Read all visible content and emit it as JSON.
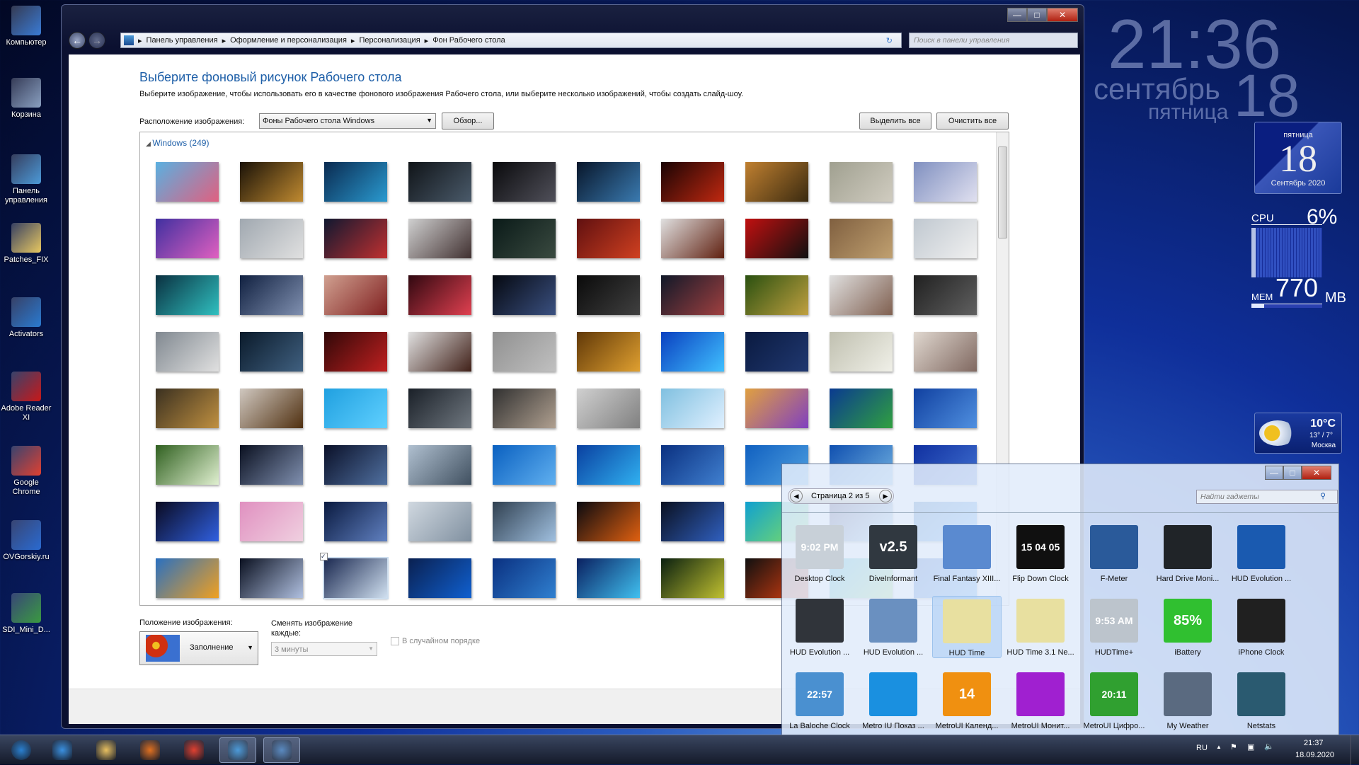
{
  "desktop": {
    "icons": [
      {
        "label": "Компьютер",
        "icon": "computer-icon",
        "color": "#3a7bd5"
      },
      {
        "label": "Корзина",
        "icon": "recycle-bin-icon",
        "color": "#8aa0c0"
      },
      {
        "label": "Панель управления",
        "icon": "control-panel-icon",
        "color": "#4c9ad8"
      },
      {
        "label": "Patches_FIX",
        "icon": "folder-icon",
        "color": "#e8c860"
      },
      {
        "label": "Activators",
        "icon": "activators-icon",
        "color": "#2a7ad0"
      },
      {
        "label": "Adobe Reader XI",
        "icon": "adobe-reader-icon",
        "color": "#c81818"
      },
      {
        "label": "Google Chrome",
        "icon": "chrome-icon",
        "color": "#e04030"
      },
      {
        "label": "OVGorskiy.ru",
        "icon": "ovgorskiy-icon",
        "color": "#2a6ad0"
      },
      {
        "label": "SDI_Mini_D...",
        "icon": "sdi-icon",
        "color": "#3a9a40"
      }
    ]
  },
  "window": {
    "controls": {
      "minimize": "—",
      "maximize": "□",
      "close": "✕"
    },
    "nav": {
      "back": "←",
      "forward": "→"
    },
    "breadcrumb": [
      "Панель управления",
      "Оформление и персонализация",
      "Персонализация",
      "Фон Рабочего стола"
    ],
    "search_placeholder": "Поиск в панели управления",
    "title": "Выберите фоновый рисунок Рабочего стола",
    "description": "Выберите изображение, чтобы использовать его в качестве фонового изображения Рабочего стола, или выберите несколько изображений, чтобы создать слайд-шоу.",
    "location_label": "Расположение изображения:",
    "location_value": "Фоны Рабочего стола Windows",
    "browse": "Обзор...",
    "select_all": "Выделить все",
    "clear_all": "Очистить все",
    "group_label": "Windows (249)",
    "thumbnail_colors": [
      [
        "#5ab0e0",
        "#e06080"
      ],
      [
        "#1a1208",
        "#c08a30"
      ],
      [
        "#0a2a50",
        "#2a9ad0"
      ],
      [
        "#101418",
        "#4a5a6a"
      ],
      [
        "#0a0a0c",
        "#50505a"
      ],
      [
        "#08162a",
        "#3a7ab0"
      ],
      [
        "#1a0404",
        "#c02810"
      ],
      [
        "#c08030",
        "#3a2a10"
      ],
      [
        "#a0a090",
        "#d0ccc0"
      ],
      [
        "#8090c0",
        "#e0e0f0"
      ],
      [
        "#4030a0",
        "#e060c0"
      ],
      [
        "#a0a8b0",
        "#e0e0e0"
      ],
      [
        "#101830",
        "#c03030"
      ],
      [
        "#d0d0d0",
        "#403030"
      ],
      [
        "#0a1a18",
        "#3a4a40"
      ],
      [
        "#601010",
        "#d04020"
      ],
      [
        "#e0e0e0",
        "#602010"
      ],
      [
        "#c01010",
        "#101010"
      ],
      [
        "#806040",
        "#c0a070"
      ],
      [
        "#c0c8d0",
        "#f0f0f0"
      ],
      [
        "#0a3040",
        "#30c0c0"
      ],
      [
        "#102040",
        "#8090b0"
      ],
      [
        "#d0a090",
        "#802020"
      ],
      [
        "#300810",
        "#e04050"
      ],
      [
        "#050810",
        "#3a5080"
      ],
      [
        "#0a0a0a",
        "#404040"
      ],
      [
        "#101828",
        "#a04040"
      ],
      [
        "#2a5010",
        "#c0a040"
      ],
      [
        "#e0e0e0",
        "#806050"
      ],
      [
        "#202020",
        "#606060"
      ],
      [
        "#808890",
        "#e0e0e0"
      ],
      [
        "#0a1a2a",
        "#406080"
      ],
      [
        "#300808",
        "#c02020"
      ],
      [
        "#e0e0e0",
        "#402018"
      ],
      [
        "#909090",
        "#c0c0c0"
      ],
      [
        "#603808",
        "#e0a030"
      ],
      [
        "#0a40c0",
        "#40c0ff"
      ],
      [
        "#0a1a40",
        "#203870"
      ],
      [
        "#c0c0b0",
        "#f0f0e8"
      ],
      [
        "#e0d8d0",
        "#806860"
      ],
      [
        "#3a3020",
        "#c09040"
      ],
      [
        "#d0c8c0",
        "#503010"
      ],
      [
        "#20a0e0",
        "#60d0ff"
      ],
      [
        "#1a2028",
        "#707880"
      ],
      [
        "#303030",
        "#b0a090"
      ],
      [
        "#d0d0d0",
        "#808080"
      ],
      [
        "#80c0e0",
        "#e0f0ff"
      ],
      [
        "#e0a040",
        "#8040c0"
      ],
      [
        "#0a3a90",
        "#30a040"
      ],
      [
        "#1040a0",
        "#5090e0"
      ],
      [
        "#306020",
        "#e0f0d0"
      ],
      [
        "#0a1020",
        "#8090b0"
      ],
      [
        "#0a1028",
        "#5070a0"
      ],
      [
        "#b0c0d0",
        "#405060"
      ],
      [
        "#0a60c0",
        "#60b0f0"
      ],
      [
        "#0a40a0",
        "#30b0f0"
      ],
      [
        "#0a3080",
        "#4080d0"
      ],
      [
        "#1060c0",
        "#50a0e0"
      ],
      [
        "#1050b0",
        "#70b0e0"
      ],
      [
        "#1030a0",
        "#4070d0"
      ],
      [
        "#0a0a20",
        "#3060e0"
      ],
      [
        "#e090c0",
        "#f0d0e0"
      ],
      [
        "#0a1a40",
        "#6080c0"
      ],
      [
        "#d0d8e0",
        "#8090a0"
      ],
      [
        "#304050",
        "#a0c0e0"
      ],
      [
        "#0a0a10",
        "#e06010"
      ],
      [
        "#0a1020",
        "#3060c0"
      ],
      [
        "#10a0d0",
        "#80e060"
      ],
      [
        "#1a0a40",
        "#a0e0ff"
      ],
      [
        "#0a50a0",
        "#40a0ff"
      ],
      [
        "#2a70c0",
        "#f0a020"
      ],
      [
        "#0a1020",
        "#b0c0e0"
      ],
      [
        "#1a2850",
        "#d0e0f0"
      ],
      [
        "#0a2050",
        "#1060d0"
      ],
      [
        "#0a3080",
        "#3080d0"
      ],
      [
        "#0a2060",
        "#40c0f0"
      ],
      [
        "#0a2010",
        "#c0c030"
      ],
      [
        "#101010",
        "#e04010"
      ],
      [
        "#10a0d0",
        "#a0e060"
      ],
      [
        "#0a40b0",
        "#3090f0"
      ]
    ],
    "position_label": "Положение изображения:",
    "position_value": "Заполнение",
    "interval_label": "Сменять изображение каждые:",
    "interval_value": "3 минуты",
    "shuffle_label": "В случайном порядке",
    "shuffle_checked": false
  },
  "gadgets": {
    "page": "Страница 2 из 5",
    "search_placeholder": "Найти гаджеты",
    "items": [
      {
        "label": "Desktop Clock",
        "glyph": "9:02 PM",
        "color": "#c8d0d8"
      },
      {
        "label": "DiveInformant",
        "glyph": "v2.5",
        "color": "#303840"
      },
      {
        "label": "Final Fantasy XIII...",
        "glyph": "",
        "color": "#5a8ad0"
      },
      {
        "label": "Flip Down Clock",
        "glyph": "15 04 05",
        "color": "#101010"
      },
      {
        "label": "F-Meter",
        "glyph": "",
        "color": "#2a5a9a"
      },
      {
        "label": "Hard Drive Moni...",
        "glyph": "",
        "color": "#202428"
      },
      {
        "label": "HUD Evolution ...",
        "glyph": "",
        "color": "#1a5ab0"
      },
      {
        "label": "HUD Evolution ...",
        "glyph": "",
        "color": "#30343a"
      },
      {
        "label": "HUD Evolution ...",
        "glyph": "",
        "color": "#6a90c0"
      },
      {
        "label": "HUD Time",
        "glyph": "",
        "color": "#e8e0a0",
        "selected": true
      },
      {
        "label": "HUD Time 3.1 Ne...",
        "glyph": "",
        "color": "#e8e0a0"
      },
      {
        "label": "HUDTime+",
        "glyph": "9:53 AM",
        "color": "#bcc4cc"
      },
      {
        "label": "iBattery",
        "glyph": "85%",
        "color": "#30c030"
      },
      {
        "label": "iPhone Clock",
        "glyph": "",
        "color": "#202020"
      },
      {
        "label": "La Baloche Clock",
        "glyph": "22:57",
        "color": "#4a90d0"
      },
      {
        "label": "Metro IU Показ ...",
        "glyph": "",
        "color": "#1a90e0"
      },
      {
        "label": "MetroUI Календ...",
        "glyph": "14",
        "color": "#f09010"
      },
      {
        "label": "MetroUI Монит...",
        "glyph": "",
        "color": "#a020d0"
      },
      {
        "label": "MetroUI Цифро...",
        "glyph": "20:11",
        "color": "#30a030"
      },
      {
        "label": "My Weather",
        "glyph": "",
        "color": "#5a6a80"
      },
      {
        "label": "Netstats",
        "glyph": "",
        "color": "#2a5a70"
      }
    ]
  },
  "clock": {
    "time": "21:36",
    "month": "сентябрь",
    "day": "18",
    "weekday": "пятница"
  },
  "calendar": {
    "weekday": "пятница",
    "day": "18",
    "month_year": "Сентябрь 2020"
  },
  "meter": {
    "cpu_label": "CPU",
    "cpu_value": "6%",
    "cpu_percent": 6,
    "mem_label": "MEM",
    "mem_value": "770",
    "mem_unit": "MB"
  },
  "weather": {
    "temp": "10°C",
    "range": "13° / 7°",
    "city": "Москва"
  },
  "taskbar": {
    "apps": [
      {
        "icon": "start-orb-icon",
        "color": "#2a80d0"
      },
      {
        "icon": "internet-explorer-icon",
        "color": "#3a90e0"
      },
      {
        "icon": "explorer-folder-icon",
        "color": "#e8c060"
      },
      {
        "icon": "media-player-icon",
        "color": "#e07020"
      },
      {
        "icon": "chrome-icon",
        "color": "#e04030"
      },
      {
        "icon": "control-panel-icon",
        "color": "#4c9ad8",
        "active": true
      },
      {
        "icon": "gadgets-icon",
        "color": "#5a8ac0",
        "active": true
      }
    ],
    "lang": "RU",
    "time": "21:37",
    "date": "18.09.2020"
  }
}
